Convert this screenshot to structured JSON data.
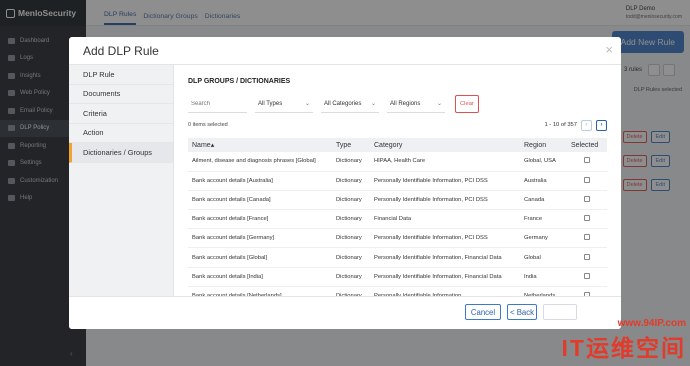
{
  "app": {
    "logo": "MenloSecurity",
    "tabs": [
      "DLP Rules",
      "Dictionary Groups",
      "Dictionaries"
    ],
    "user": {
      "name": "DLP Demo",
      "email": "todd@menlosecurity.com"
    },
    "sidebar": [
      "Dashboard",
      "Logs",
      "Insights",
      "Web Policy",
      "Email Policy",
      "DLP Policy",
      "Reporting",
      "Settings",
      "Customization",
      "Help"
    ],
    "add_button": "Add New Rule",
    "rules_count": "3 rules",
    "selected_info": "DLP Rules selected",
    "row_delete": "Delete",
    "row_edit": "Edit"
  },
  "modal": {
    "title": "Add DLP Rule",
    "close": "×",
    "nav": [
      "DLP Rule",
      "Documents",
      "Criteria",
      "Action",
      "Dictionaries / Groups"
    ],
    "section_title": "DLP GROUPS / DICTIONARIES",
    "filters": {
      "search_placeholder": "Search",
      "types": "All Types",
      "categories": "All Categories",
      "regions": "All Regions",
      "clear": "Clear"
    },
    "selected_count": "0 items selected",
    "pagination": "1 - 10 of 357",
    "columns": [
      "Name",
      "Type",
      "Category",
      "Region",
      "Selected"
    ],
    "sort_indicator": "▴",
    "rows": [
      [
        "Ailment, disease and diagnosis phrases [Global]",
        "Dictionary",
        "HIPAA, Health Care",
        "Global, USA"
      ],
      [
        "Bank account details [Australia]",
        "Dictionary",
        "Personally Identifiable Information, PCI DSS",
        "Australia"
      ],
      [
        "Bank account details [Canada]",
        "Dictionary",
        "Personally Identifiable Information, PCI DSS",
        "Canada"
      ],
      [
        "Bank account details [France]",
        "Dictionary",
        "Financial Data",
        "France"
      ],
      [
        "Bank account details [Germany]",
        "Dictionary",
        "Personally Identifiable Information, PCI DSS",
        "Germany"
      ],
      [
        "Bank account details [Global]",
        "Dictionary",
        "Personally Identifiable Information, Financial Data",
        "Global"
      ],
      [
        "Bank account details [India]",
        "Dictionary",
        "Personally Identifiable Information, Financial Data",
        "India"
      ],
      [
        "Bank account details [Netherlands]",
        "Dictionary",
        "Personally Identifiable Information",
        "Netherlands"
      ]
    ],
    "footer": {
      "cancel": "Cancel",
      "back": "< Back"
    }
  },
  "watermark": {
    "url": "www.94IP.com",
    "text": "IT运维空间"
  },
  "colors": {
    "accent": "#3f7ac8",
    "danger": "#d9534f",
    "active_tab": "#f0a330",
    "sidebar_bg": "#262b33"
  }
}
